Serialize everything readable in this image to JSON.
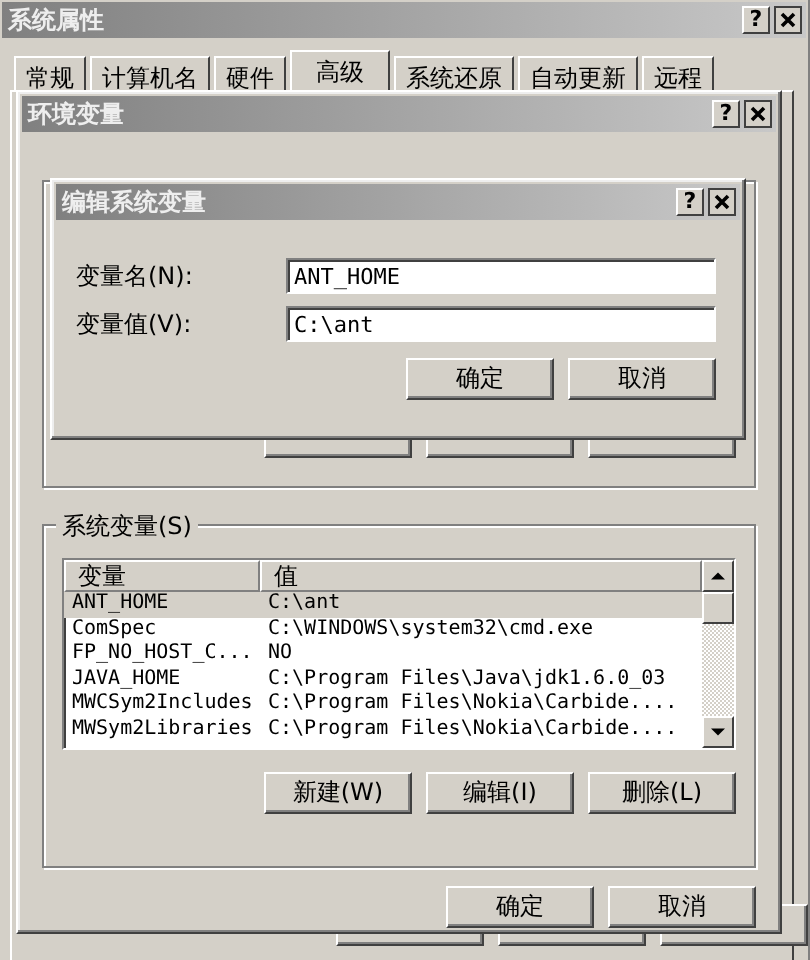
{
  "system_window": {
    "title": "系统属性",
    "help": "?",
    "tabs": [
      {
        "label": "常规",
        "selected": false
      },
      {
        "label": "计算机名",
        "selected": false
      },
      {
        "label": "硬件",
        "selected": false
      },
      {
        "label": "高级",
        "selected": true
      },
      {
        "label": "系统还原",
        "selected": false
      },
      {
        "label": "自动更新",
        "selected": false
      },
      {
        "label": "远程",
        "selected": false
      }
    ]
  },
  "env_dialog": {
    "title": "环境变量",
    "help": "?",
    "system_group": {
      "label": "系统变量(S)",
      "columns": [
        "变量",
        "值"
      ],
      "rows": [
        {
          "name": "ANT_HOME",
          "value": "C:\\ant",
          "selected": true
        },
        {
          "name": "ComSpec",
          "value": "C:\\WINDOWS\\system32\\cmd.exe",
          "selected": false
        },
        {
          "name": "FP_NO_HOST_C...",
          "value": "NO",
          "selected": false
        },
        {
          "name": "JAVA_HOME",
          "value": "C:\\Program Files\\Java\\jdk1.6.0_03",
          "selected": false
        },
        {
          "name": "MWCSym2Includes",
          "value": "C:\\Program Files\\Nokia\\Carbide....",
          "selected": false
        },
        {
          "name": "MWSym2Libraries",
          "value": "C:\\Program Files\\Nokia\\Carbide....",
          "selected": false
        }
      ],
      "buttons": [
        "新建(W)",
        "编辑(I)",
        "删除(L)"
      ]
    },
    "buttons": [
      "确定",
      "取消"
    ]
  },
  "edit_dialog": {
    "title": "编辑系统变量",
    "help": "?",
    "fields": [
      {
        "label": "变量名(N):",
        "value": "ANT_HOME"
      },
      {
        "label": "变量值(V):",
        "value": "C:\\ant"
      }
    ],
    "buttons": [
      "确定",
      "取消"
    ]
  }
}
